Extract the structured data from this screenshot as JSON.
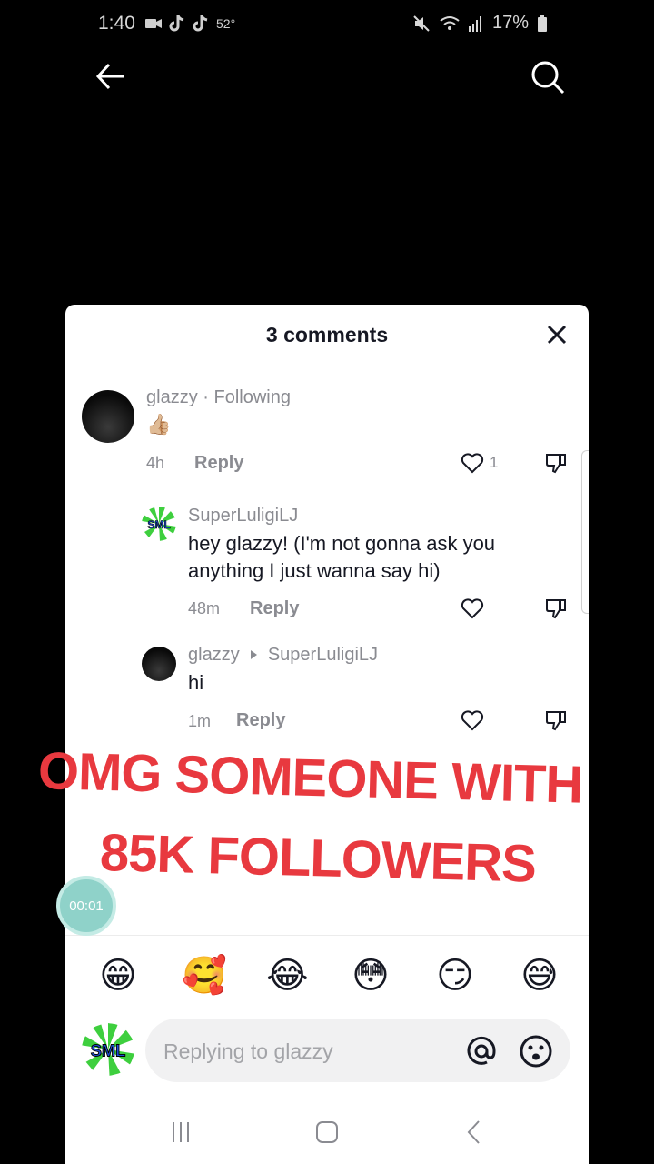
{
  "status": {
    "time": "1:40",
    "temperature": "52°",
    "battery": "17%",
    "icons": [
      "camera-icon",
      "tiktok-icon",
      "tiktok-icon",
      "mute-icon",
      "wifi-icon",
      "signal-icon",
      "battery-icon"
    ]
  },
  "topbar": {
    "back_icon": "back-arrow-icon",
    "search_icon": "search-icon"
  },
  "sheet": {
    "title": "3 comments",
    "close_icon": "close-icon",
    "comments": [
      {
        "username": "glazzy",
        "separator": " · ",
        "tag": "Following",
        "text": "👍🏼",
        "time": "4h",
        "reply_label": "Reply",
        "likes": "1"
      },
      {
        "username": "SuperLuligiLJ",
        "text_line1": "hey glazzy! (I'm not gonna ask you",
        "text_line2": "anything I just wanna say hi)",
        "time": "48m",
        "reply_label": "Reply"
      },
      {
        "username": "glazzy",
        "reply_to": "SuperLuligiLJ",
        "text": "hi",
        "time": "1m",
        "reply_label": "Reply"
      }
    ],
    "emojis": [
      "😁",
      "🥰",
      "😂",
      "😳",
      "😏",
      "😅"
    ],
    "input": {
      "placeholder": "Replying to glazzy"
    }
  },
  "overlay": {
    "line1": "OMG SOMEONE WITH",
    "line2": "85K FOLLOWERS",
    "timer": "00:01",
    "accent": "#e8393f"
  },
  "avatar_text": "SML"
}
